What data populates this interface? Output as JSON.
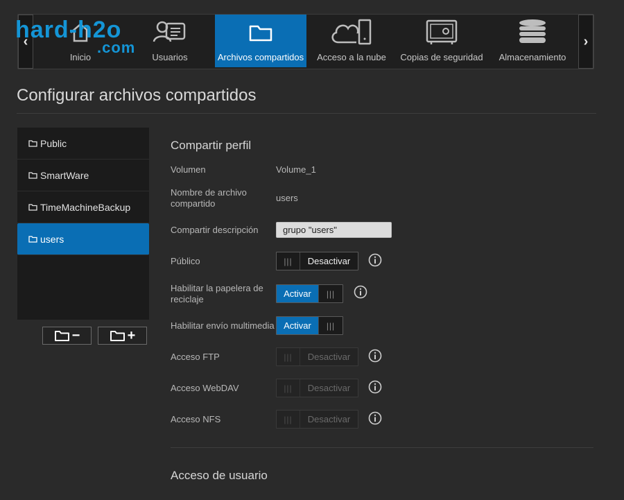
{
  "nav": {
    "items": [
      {
        "label": "Inicio",
        "icon": "home-icon"
      },
      {
        "label": "Usuarios",
        "icon": "users-icon"
      },
      {
        "label": "Archivos compartidos",
        "icon": "folder-icon",
        "active": true
      },
      {
        "label": "Acceso a la nube",
        "icon": "cloud-device-icon"
      },
      {
        "label": "Copias de seguridad",
        "icon": "safe-icon"
      },
      {
        "label": "Almacenamiento",
        "icon": "storage-icon"
      }
    ],
    "prev_arrow": "‹",
    "next_arrow": "›"
  },
  "watermark": {
    "line1": "hard-h2o",
    "line2": ".com"
  },
  "page": {
    "title": "Configurar archivos compartidos"
  },
  "shares": {
    "items": [
      {
        "name": "Public"
      },
      {
        "name": "SmartWare"
      },
      {
        "name": "TimeMachineBackup"
      },
      {
        "name": "users",
        "active": true
      }
    ],
    "remove_symbol": "−",
    "add_symbol": "+"
  },
  "profile": {
    "title": "Compartir perfil",
    "volume_label": "Volumen",
    "volume_value": "Volume_1",
    "share_name_label": "Nombre de archivo compartido",
    "share_name_value": "users",
    "description_label": "Compartir descripción",
    "description_value": "grupo \"users\"",
    "public_label": "Público",
    "public_state": "Desactivar",
    "recycle_label": "Habilitar la papelera de reciclaje",
    "recycle_state": "Activar",
    "media_label": "Habilitar envío multimedia",
    "media_state": "Activar",
    "ftp_label": "Acceso FTP",
    "ftp_state": "Desactivar",
    "webdav_label": "Acceso WebDAV",
    "webdav_state": "Desactivar",
    "nfs_label": "Acceso NFS",
    "nfs_state": "Desactivar",
    "grip": "|||"
  },
  "user_access": {
    "title": "Acceso de usuario"
  },
  "colors": {
    "accent": "#0a6eb4",
    "background": "#2a2a2a",
    "panel": "#1b1b1b",
    "watermark": "#1495d6"
  }
}
